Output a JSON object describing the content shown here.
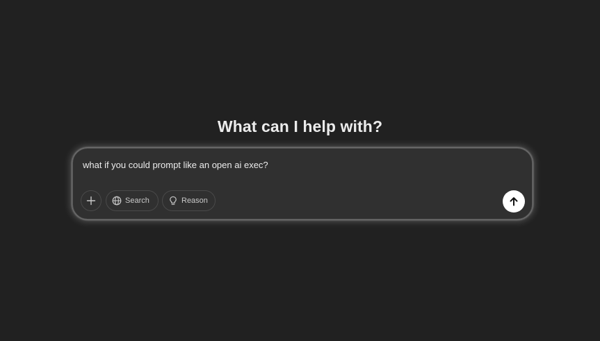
{
  "main": {
    "heading": "What can I help with?"
  },
  "composer": {
    "input_value": "what if you could prompt like an open ai exec?",
    "attach_icon": "plus-icon",
    "search_label": "Search",
    "search_icon": "globe-icon",
    "reason_label": "Reason",
    "reason_icon": "lightbulb-icon",
    "send_icon": "arrow-up-icon"
  }
}
